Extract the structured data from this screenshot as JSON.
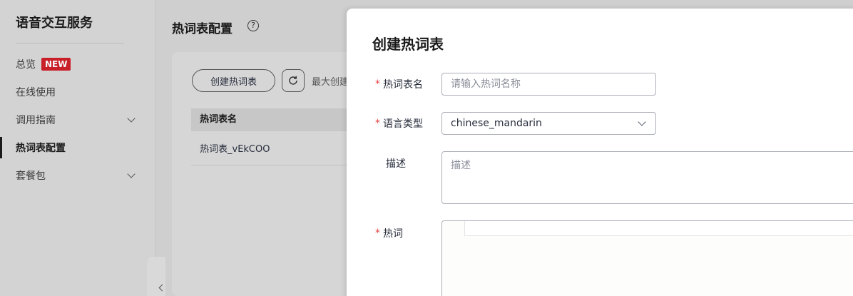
{
  "sidebar": {
    "title": "语音交互服务",
    "items": [
      {
        "label": "总览",
        "badge": "NEW"
      },
      {
        "label": "在线使用"
      },
      {
        "label": "调用指南"
      },
      {
        "label": "热词表配置"
      },
      {
        "label": "套餐包"
      }
    ]
  },
  "main": {
    "title": "热词表配置",
    "help_icon": "?",
    "create_button": "创建热词表",
    "max_text": "最大创建",
    "table": {
      "header": "热词表名",
      "rows": [
        "热词表_vEkCOO"
      ]
    }
  },
  "drawer": {
    "title": "创建热词表",
    "name_label": "热词表名",
    "name_placeholder": "请输入热词名称",
    "lang_label": "语言类型",
    "lang_value": "chinese_mandarin",
    "desc_label": "描述",
    "desc_placeholder": "描述",
    "words_label": "热词",
    "required_mark": "*"
  },
  "colors": {
    "required": "#e54545",
    "badge": "#c7000b",
    "overlay": "#cfcfcf"
  }
}
